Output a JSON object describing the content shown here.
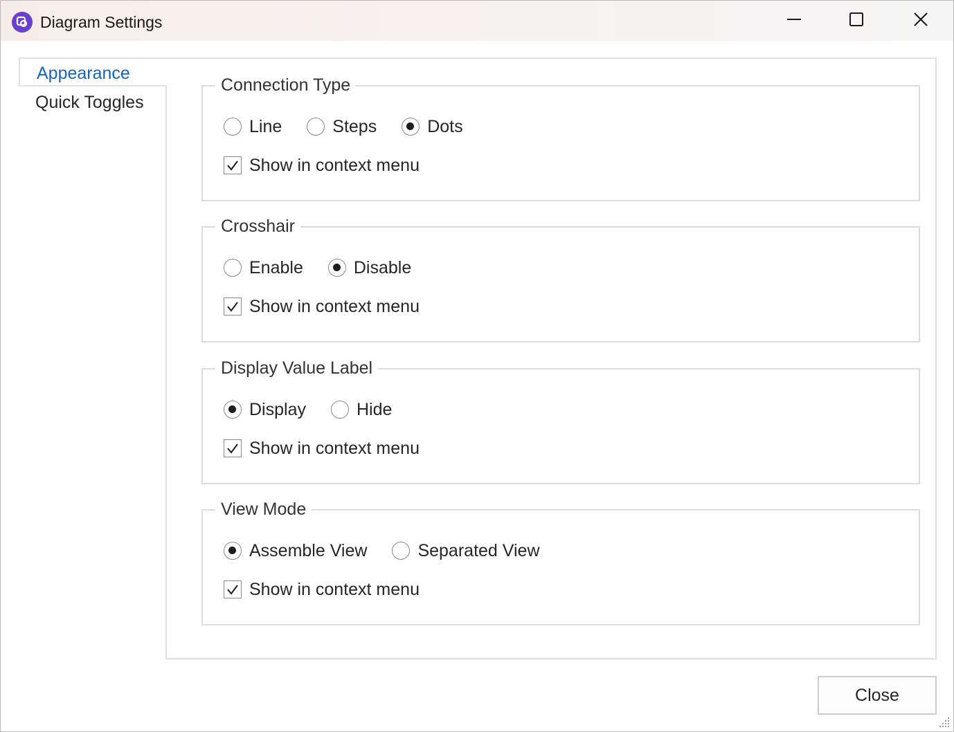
{
  "window": {
    "title": "Diagram Settings",
    "icon": "app-logo-icon",
    "controls": [
      "minimize-icon",
      "maximize-icon",
      "close-icon"
    ]
  },
  "nav": {
    "items": [
      {
        "label": "Appearance",
        "selected": true
      },
      {
        "label": "Quick Toggles",
        "selected": false
      }
    ]
  },
  "groups": [
    {
      "title": "Connection Type",
      "options": [
        {
          "label": "Line",
          "checked": false
        },
        {
          "label": "Steps",
          "checked": false
        },
        {
          "label": "Dots",
          "checked": true
        }
      ],
      "checkbox": {
        "label": "Show in context menu",
        "checked": true
      }
    },
    {
      "title": "Crosshair",
      "options": [
        {
          "label": "Enable",
          "checked": false
        },
        {
          "label": "Disable",
          "checked": true
        }
      ],
      "checkbox": {
        "label": "Show in context menu",
        "checked": true
      }
    },
    {
      "title": "Display Value Label",
      "options": [
        {
          "label": "Display",
          "checked": true
        },
        {
          "label": "Hide",
          "checked": false
        }
      ],
      "checkbox": {
        "label": "Show in context menu",
        "checked": true
      }
    },
    {
      "title": "View Mode",
      "options": [
        {
          "label": "Assemble View",
          "checked": true
        },
        {
          "label": "Separated View",
          "checked": false
        }
      ],
      "checkbox": {
        "label": "Show in context menu",
        "checked": true
      }
    }
  ],
  "footer": {
    "close_label": "Close"
  },
  "colors": {
    "accent": "#1565c0",
    "app_icon": "#6a3fd0"
  }
}
